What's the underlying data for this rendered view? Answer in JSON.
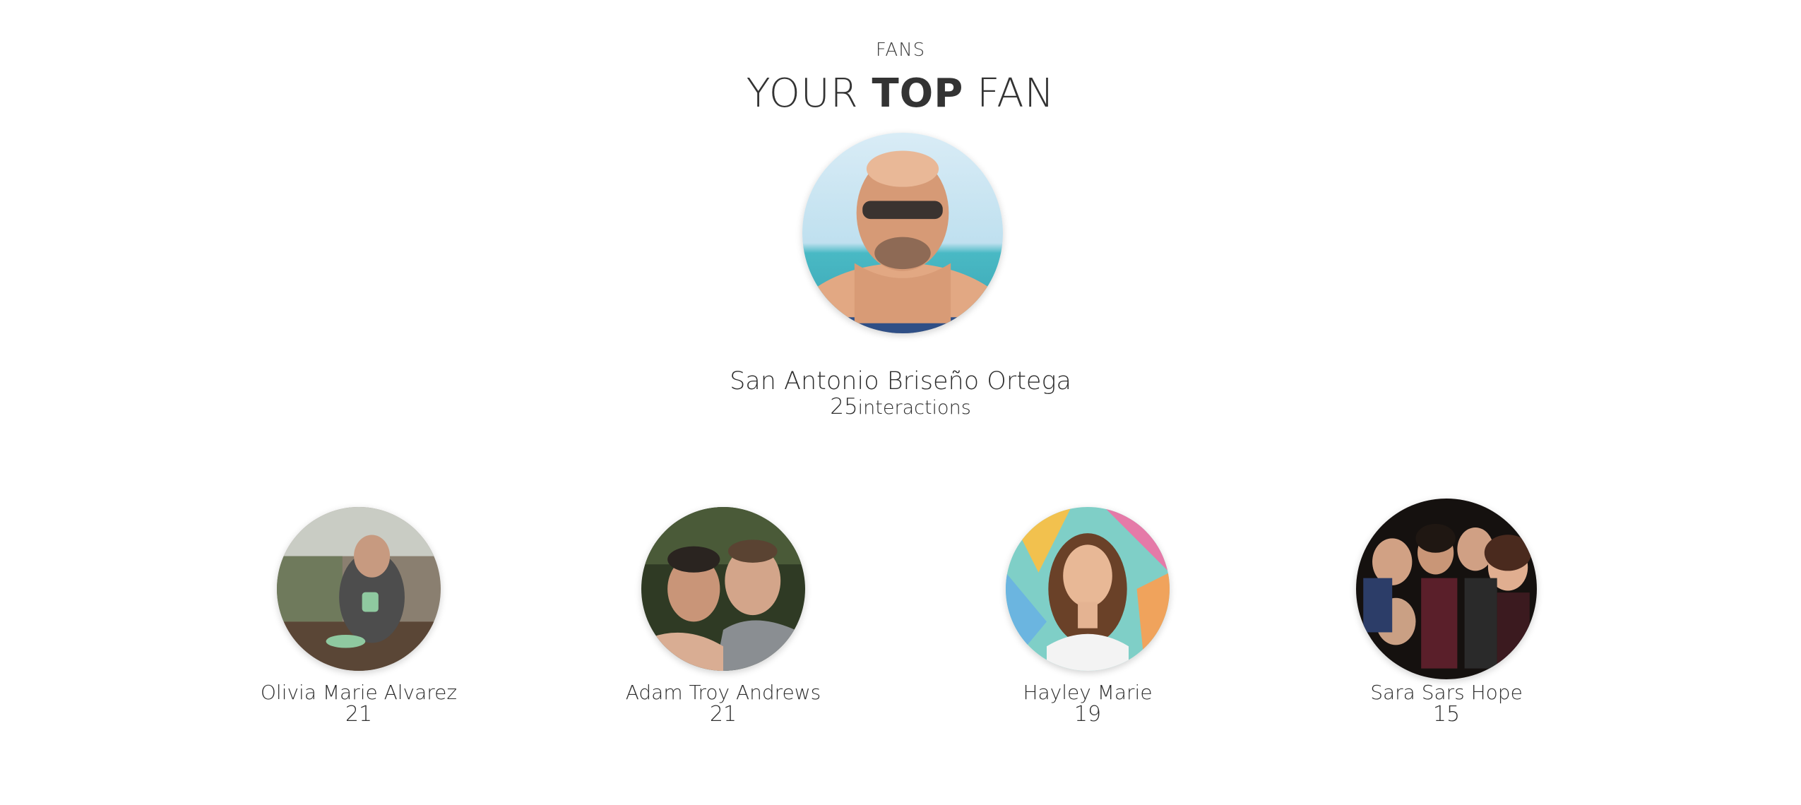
{
  "header": {
    "section_label": "FANS",
    "title_prefix": "YOUR",
    "title_emphasis": "TOP",
    "title_suffix": "FAN"
  },
  "top_fan": {
    "name": "San Antonio Briseño Ortega",
    "count": "25",
    "count_suffix": "interactions",
    "avatar_icon": "profile-photo"
  },
  "fans": [
    {
      "name": "Olivia Marie Alvarez",
      "count": "21",
      "avatar_icon": "profile-photo"
    },
    {
      "name": "Adam Troy Andrews",
      "count": "21",
      "avatar_icon": "profile-photo"
    },
    {
      "name": "Hayley Marie",
      "count": "19",
      "avatar_icon": "profile-photo"
    },
    {
      "name": "Sara Sars Hope",
      "count": "15",
      "avatar_icon": "profile-photo"
    }
  ]
}
